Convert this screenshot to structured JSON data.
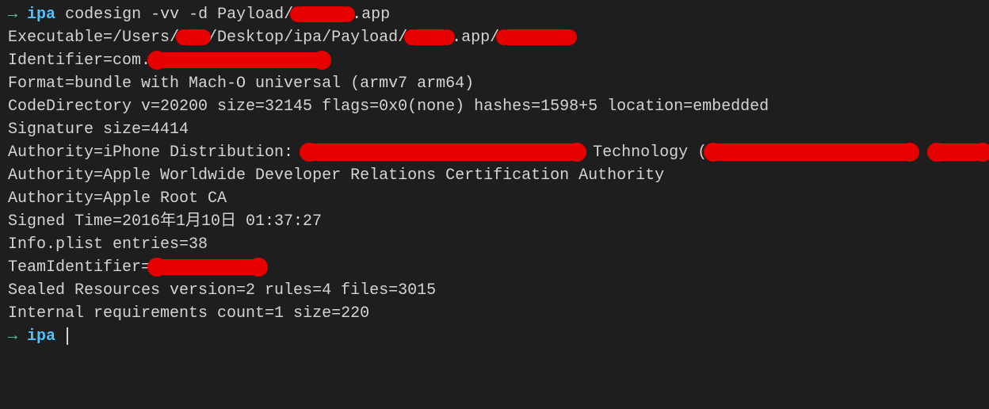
{
  "prompt": {
    "arrow": "→",
    "dir": "ipa"
  },
  "command": "codesign -vv -d Payload/",
  "command_suffix": ".app",
  "output": {
    "exec_prefix": "Executable=/Users/",
    "exec_mid1": "/Desktop/ipa/Payload/",
    "exec_mid2": ".app/",
    "identifier_prefix": "Identifier=com.",
    "format": "Format=bundle with Mach-O universal (armv7 arm64)",
    "code_directory": "CodeDirectory v=20200 size=32145 flags=0x0(none) hashes=1598+5 location=embedded",
    "sig_size": "Signature size=4414",
    "auth1_prefix": "Authority=iPhone Distribution: ",
    "auth2": "Authority=Apple Worldwide Developer Relations Certification Authority",
    "auth3": "Authority=Apple Root CA",
    "signed_time": "Signed Time=2016年1月10日  01:37:27",
    "info_plist": "Info.plist entries=38",
    "team_id_prefix": "TeamIdentifier=",
    "sealed": "Sealed Resources version=2 rules=4 files=3015",
    "internal": "Internal requirements count=1 size=220"
  }
}
